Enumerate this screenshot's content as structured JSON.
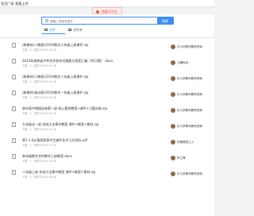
{
  "nav": {
    "items": [
      "首页",
      "广场",
      "我要上传"
    ]
  },
  "alert": {
    "text": "博客不存在"
  },
  "search": {
    "placeholder": "请输入搜索关键字",
    "button_label": "搜索"
  },
  "tabs": [
    {
      "label": "文件",
      "icon": "document-icon",
      "active": true
    },
    {
      "label": "文件夹",
      "icon": "folder-icon",
      "active": false
    }
  ],
  "files": [
    {
      "name": "(新教材)人教版(2019)数学二年级上册课件.zip",
      "meta": "下载：0 · 发布于2024-02-28",
      "author": "中小学教材教学资料"
    },
    {
      "name": "2023年湖南省中考化学各年份真题与答案汇编（共23套）.docx",
      "meta": "下载：0 · 发布于2023-07-30",
      "author": "斗鹿地冰"
    },
    {
      "name": "(新教材)人教版(2019)数学三年级上册课件.zip",
      "meta": "下载：0 · 发布于2024-02-28",
      "author": "中小学教材教学资料"
    },
    {
      "name": "(新教材)青岛版(2019)数学一年级上册课件.zip",
      "meta": "下载：0 · 发布于2024-02-28",
      "author": "中小学教材教学资料"
    },
    {
      "name": "高中高中物理必修第一册 核心素养教案+课件+习题训练.zip",
      "meta": "下载：0 · 发布于2024-07-30",
      "author": "中小学教材教学资料"
    },
    {
      "name": "九年级全一册 合成大全章节教案 课件+教案+素材.zip",
      "meta": "下载：0 · 发布于2024-02-28",
      "author": "中小学教材教学资料"
    },
    {
      "name": "第1.1.6从我国到高中生课件及学习文资料.pdf",
      "meta": "下载：0 · 发布于2024-07-30",
      "author": "你爸爸的乙人"
    },
    {
      "name": "各年级数学学科教学上册教案.docx",
      "meta": "下载：0 · 发布于2024-02-28",
      "author": "科之神"
    },
    {
      "name": "八年级上册 合成大全章节教案 课件+教案+素材.zip",
      "meta": "下载：0 · 发布于2024-02-28",
      "author": "中小学教材教学资料"
    }
  ]
}
